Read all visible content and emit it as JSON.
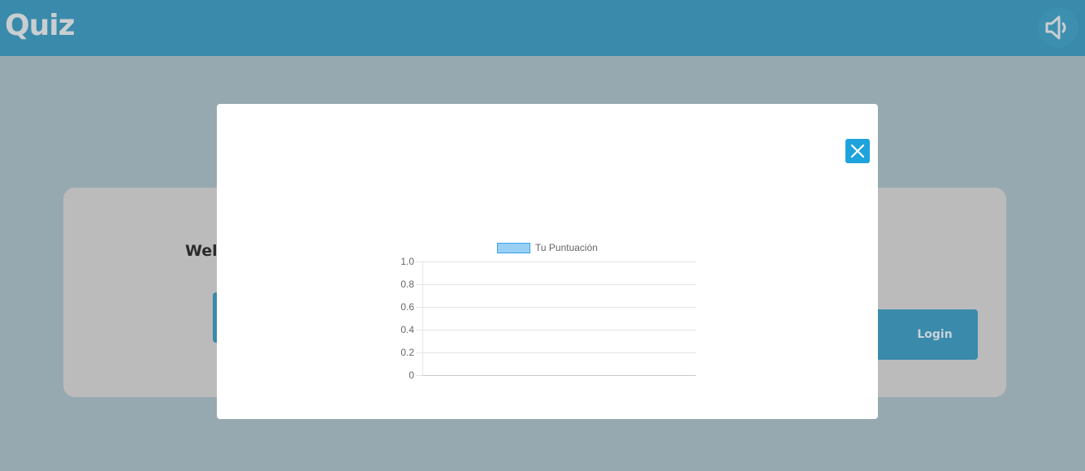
{
  "header": {
    "title": "Quiz",
    "sound_icon": "speaker-icon"
  },
  "background_card": {
    "welcome_text_visible": "Wel",
    "login_label": "Login"
  },
  "modal": {
    "close_icon": "close-icon",
    "close_color": "#1fa3dd"
  },
  "chart_data": {
    "type": "bar",
    "legend": [
      "Tu Puntuación"
    ],
    "legend_position": "top",
    "series": [
      {
        "name": "Tu Puntuación",
        "values": [],
        "color": "#9ad0f5",
        "border_color": "#36a2eb"
      }
    ],
    "categories": [],
    "y_ticks": [
      "0",
      "0.2",
      "0.4",
      "0.6",
      "0.8",
      "1.0"
    ],
    "ylim": [
      0,
      1.0
    ],
    "grid": true
  },
  "colors": {
    "header": "#3a8aab",
    "overlay": "#97a9b0",
    "card": "#bbbbbb",
    "accent": "#3a8aab"
  }
}
